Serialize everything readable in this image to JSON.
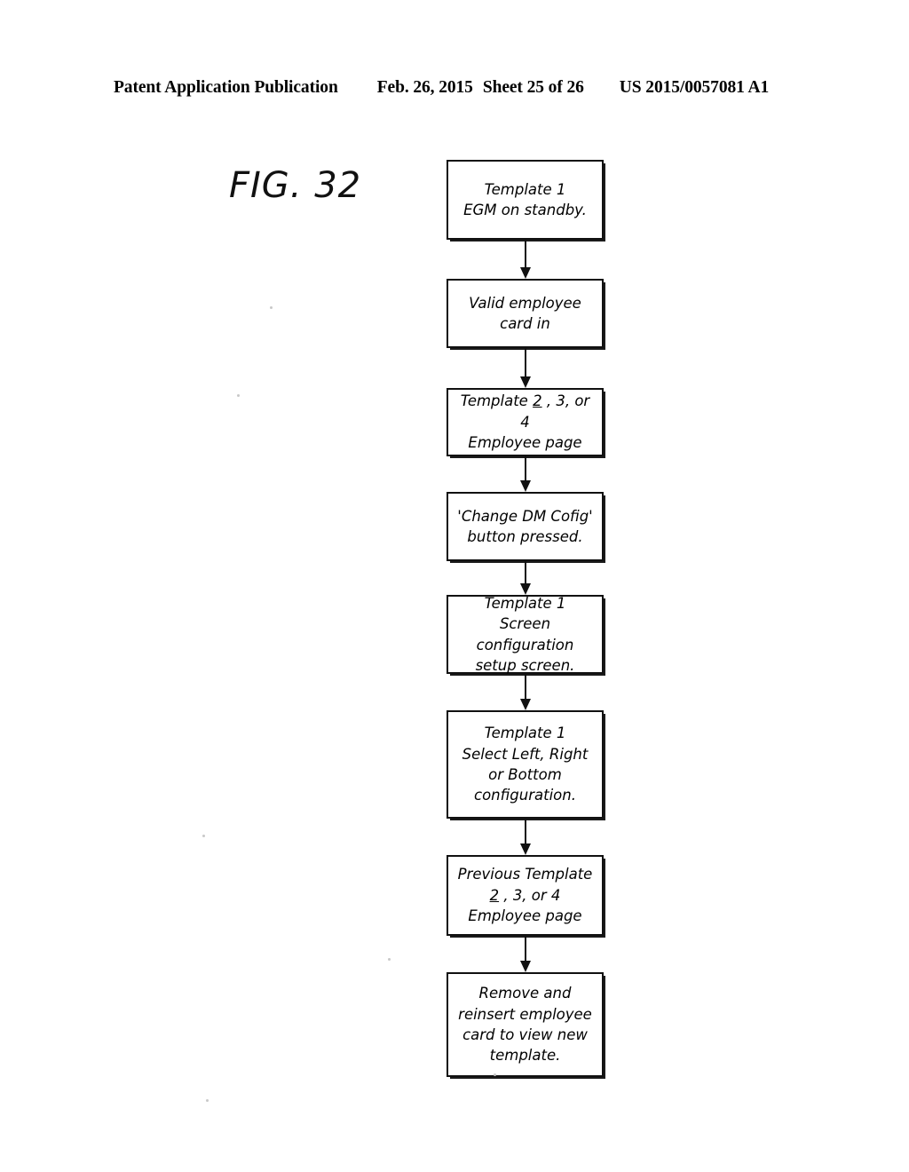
{
  "header": {
    "publication": "Patent Application Publication",
    "date": "Feb. 26, 2015",
    "sheet": "Sheet 25 of 26",
    "patent_number": "US 2015/0057081 A1"
  },
  "figure": {
    "label": "FIG. 32"
  },
  "flowchart": {
    "type": "flowchart",
    "orientation": "vertical",
    "connector": "arrow-down",
    "nodes": [
      {
        "id": "node-1",
        "name": "template-1-egm-standby",
        "lines": [
          "Template 1",
          "EGM on standby."
        ],
        "text": "Template 1\nEGM on standby."
      },
      {
        "id": "node-2",
        "name": "valid-employee-card-in",
        "lines": [
          "Valid employee",
          "card in"
        ],
        "text": "Valid employee\ncard in"
      },
      {
        "id": "node-3",
        "name": "template-2-3-4-employee-page",
        "lines": [
          "Template 2 , 3, or 4",
          "Employee page"
        ],
        "text": "Template 2 , 3, or 4\nEmployee page",
        "underlined_token": "2"
      },
      {
        "id": "node-4",
        "name": "change-dm-cofig-button-pressed",
        "lines": [
          "'Change DM Cofig'",
          "button pressed."
        ],
        "text": "'Change DM Cofig'\nbutton pressed."
      },
      {
        "id": "node-5",
        "name": "template-1-screen-configuration-setup",
        "lines": [
          "Template 1",
          "Screen configuration",
          "setup screen."
        ],
        "text": "Template 1\nScreen configuration\nsetup screen."
      },
      {
        "id": "node-6",
        "name": "template-1-select-left-right-bottom",
        "lines": [
          "Template 1",
          "Select Left, Right",
          "or Bottom",
          "configuration."
        ],
        "text": "Template 1\nSelect Left, Right\nor Bottom\nconfiguration."
      },
      {
        "id": "node-7",
        "name": "previous-template-2-3-4-employee-page",
        "lines": [
          "Previous Template",
          "2 , 3, or 4",
          "Employee page"
        ],
        "text": "Previous Template\n2 , 3, or 4\nEmployee page",
        "underlined_token": "2"
      },
      {
        "id": "node-8",
        "name": "remove-reinsert-employee-card",
        "lines": [
          "Remove and",
          "reinsert employee",
          "card to view new",
          "template."
        ],
        "text": "Remove and\nreinsert employee\ncard to view new\ntemplate."
      }
    ]
  },
  "colors": {
    "ink": "#111111",
    "paper": "#ffffff"
  }
}
